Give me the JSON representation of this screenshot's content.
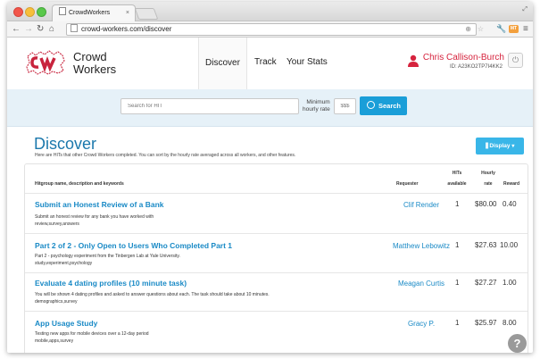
{
  "browser": {
    "tab_title": "CrowdWorkers",
    "tab_close": "×",
    "url": "crowd-workers.com/discover",
    "ext_badge": "MT"
  },
  "site": {
    "brand_line1": "Crowd",
    "brand_line2": "Workers",
    "nav": [
      "Discover",
      "Track",
      "Your Stats"
    ],
    "user_name": "Chris Callison-Burch",
    "user_id": "ID: A23KO2TP7I4KK2"
  },
  "search": {
    "placeholder": "Search for HIT",
    "minrate_label_1": "Minimum",
    "minrate_label_2": "hourly rate",
    "minrate_placeholder": "$$$",
    "button_label": "Search"
  },
  "discover": {
    "title": "Discover",
    "description": "Here are HITs that other Crowd Workers completed. You can sort by the hourly rate averaged across all workers, and other features.",
    "display_button": "Display"
  },
  "table": {
    "headers": {
      "hitgroup": "Hitgroup name, description and keywords",
      "requester": "Requester",
      "hits_1": "HITs",
      "hits_2": "available",
      "hourly_1": "Hourly",
      "hourly_2": "rate",
      "reward": "Reward"
    },
    "rows": [
      {
        "title": "Submit an Honest Review of a Bank",
        "desc1": "Submit an honest review for any bank you have worked with",
        "desc2": "review,survey,answers",
        "requester": "Clif Render",
        "hits": "1",
        "rate": "$80.00",
        "reward": "0.40"
      },
      {
        "title": "Part 2 of 2 - Only Open to Users Who Completed Part 1",
        "desc1": "Part 2 - psychology experiment from the Tinbergen Lab at Yale University.",
        "desc2": "study,experiment,psychology",
        "requester": "Matthew Lebowitz",
        "hits": "1",
        "rate": "$27.63",
        "reward": "10.00"
      },
      {
        "title": "Evaluate 4 dating profiles (10 minute task)",
        "desc1": "You will be shown 4 dating profiles and asked to answer questions about each. The task should take about 10 minutes.",
        "desc2": "demographics,survey",
        "requester": "Meagan Curtis",
        "hits": "1",
        "rate": "$27.27",
        "reward": "1.00"
      },
      {
        "title": "App Usage Study",
        "desc1": "Testing new apps for mobile devices over a 12-day period",
        "desc2": "mobile,apps,survey",
        "requester": "Gracy P.",
        "hits": "1",
        "rate": "$25.97",
        "reward": "8.00"
      }
    ]
  },
  "help_label": "?",
  "colors": {
    "accent": "#1a9ed8",
    "link": "#1a8ac6",
    "user": "#d6243e",
    "logo": "#c8243d"
  }
}
